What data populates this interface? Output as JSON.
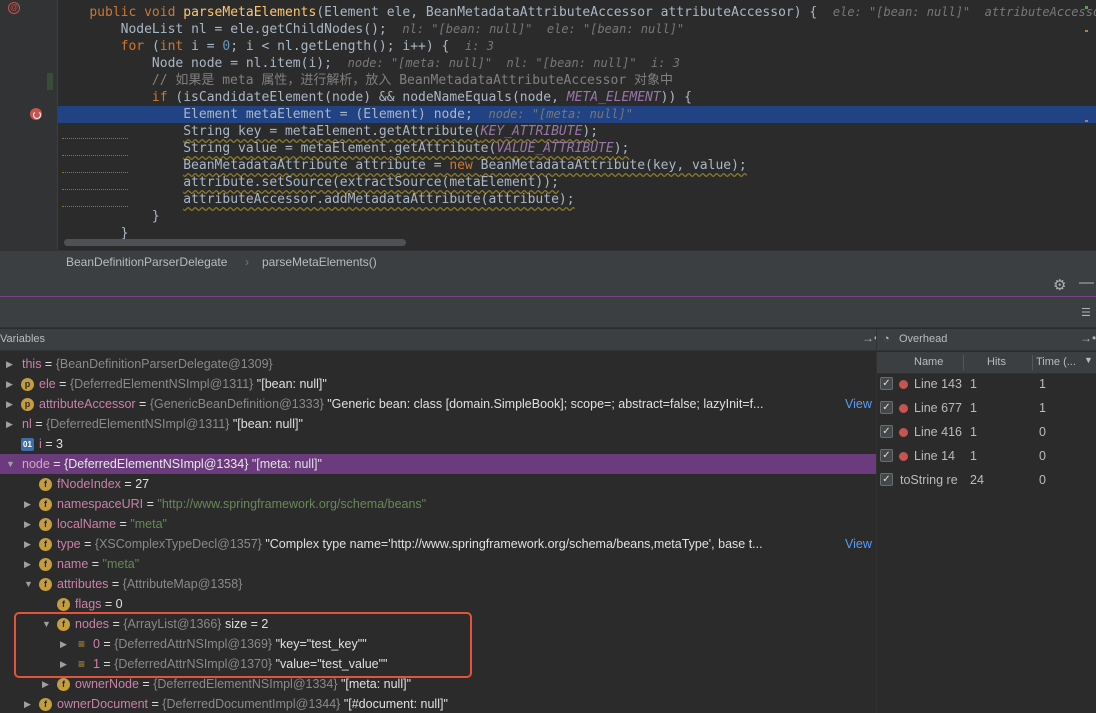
{
  "editor": {
    "line_numbers": [
      "",
      "",
      "",
      "",
      "",
      "",
      "",
      "",
      "",
      "",
      "",
      "",
      "",
      ""
    ],
    "lines": [
      {
        "indent": "    ",
        "segments": [
          [
            "kw",
            "public "
          ],
          [
            "kw",
            "void "
          ],
          [
            "fn",
            "parseMetaElements"
          ],
          [
            "",
            "(Element ele, BeanMetadataAttributeAccessor attributeAccessor) {  "
          ],
          [
            "hint",
            "ele: \"[bean: null]\"  attributeAccessor"
          ]
        ]
      },
      {
        "indent": "        ",
        "segments": [
          [
            "",
            "NodeList nl = ele.getChildNodes();  "
          ],
          [
            "hint",
            "nl: \"[bean: null]\"  ele: \"[bean: null]\""
          ]
        ]
      },
      {
        "indent": "        ",
        "segments": [
          [
            "kw",
            "for "
          ],
          [
            "",
            "("
          ],
          [
            "kw",
            "int "
          ],
          [
            "",
            "i = "
          ],
          [
            "num",
            "0"
          ],
          [
            "",
            "; i < nl.getLength(); i++) {  "
          ],
          [
            "hint",
            "i: 3"
          ]
        ]
      },
      {
        "indent": "            ",
        "segments": [
          [
            "",
            "Node node = nl.item(i);  "
          ],
          [
            "hint",
            "node: \"[meta: null]\"  nl: \"[bean: null]\"  i: 3"
          ]
        ]
      },
      {
        "indent": "            ",
        "segments": [
          [
            "cm",
            "// 如果是 meta 属性，进行解析，放入 BeanMetadataAttributeAccessor 对象中"
          ]
        ]
      },
      {
        "indent": "            ",
        "segments": [
          [
            "kw",
            "if "
          ],
          [
            "",
            "(isCandidateElement(node) && nodeNameEquals(node, "
          ],
          [
            "cst",
            "META_ELEMENT"
          ],
          [
            "",
            ")) {"
          ]
        ]
      },
      {
        "indent": "                ",
        "segments": [
          [
            "",
            "Element metaElement = (Element) node;  "
          ],
          [
            "hint",
            "node: \"[meta: null]\""
          ]
        ]
      },
      {
        "indent": "                ",
        "segments": [
          [
            "",
            "String key = metaElement.getAttribute("
          ],
          [
            "cst",
            "KEY_ATTRIBUTE"
          ],
          [
            "",
            ");"
          ]
        ]
      },
      {
        "indent": "                ",
        "segments": [
          [
            "",
            "String value = metaElement.getAttribute("
          ],
          [
            "cst",
            "VALUE_ATTRIBUTE"
          ],
          [
            "",
            ");"
          ]
        ]
      },
      {
        "indent": "                ",
        "segments": [
          [
            "",
            "BeanMetadataAttribute attribute = "
          ],
          [
            "kw",
            "new "
          ],
          [
            "",
            "BeanMetadataAttribute(key, value);"
          ]
        ]
      },
      {
        "indent": "                ",
        "segments": [
          [
            "",
            "attribute.setSource(extractSource(metaElement));"
          ]
        ]
      },
      {
        "indent": "                ",
        "segments": [
          [
            "",
            "attributeAccessor.addMetadataAttribute(attribute);"
          ]
        ]
      },
      {
        "indent": "            ",
        "segments": [
          [
            "",
            "}"
          ]
        ]
      },
      {
        "indent": "        ",
        "segments": [
          [
            "",
            "}"
          ]
        ]
      }
    ]
  },
  "breadcrumb": {
    "class_name": "BeanDefinitionParserDelegate",
    "method_name": "parseMetaElements()"
  },
  "variables": {
    "header": "Variables",
    "view_label": "View",
    "rows": [
      {
        "level": 0,
        "tri": "▶",
        "icon": "",
        "name": "this",
        "eq": " = ",
        "type": "{BeanDefinitionParserDelegate@1309}",
        "val": ""
      },
      {
        "level": 0,
        "tri": "▶",
        "icon": "p",
        "name": "ele",
        "eq": " = ",
        "type": "{DeferredElementNSImpl@1311}",
        "val": " \"[bean: null]\""
      },
      {
        "level": 0,
        "tri": "▶",
        "icon": "p",
        "name": "attributeAccessor",
        "eq": " = ",
        "type": "{GenericBeanDefinition@1333}",
        "val": " \"Generic bean: class [domain.SimpleBook]; scope=; abstract=false; lazyInit=f...",
        "view": true
      },
      {
        "level": 0,
        "tri": "▶",
        "icon": "",
        "name": "nl",
        "eq": " = ",
        "type": "{DeferredElementNSImpl@1311}",
        "val": " \"[bean: null]\""
      },
      {
        "level": 0,
        "tri": "",
        "icon": "i",
        "name": "i",
        "eq": " = ",
        "type": "",
        "val": "3"
      },
      {
        "level": 0,
        "tri": "▼",
        "icon": "",
        "name": "node",
        "eq": " = ",
        "type": "{DeferredElementNSImpl@1334}",
        "val": " \"[meta: null]\"",
        "sel": true
      },
      {
        "level": 1,
        "tri": "",
        "icon": "f",
        "name": "fNodeIndex",
        "eq": " = ",
        "type": "",
        "val": "27"
      },
      {
        "level": 1,
        "tri": "▶",
        "icon": "f",
        "name": "namespaceURI",
        "eq": " = ",
        "type": "",
        "val": "",
        "str": "\"http://www.springframework.org/schema/beans\""
      },
      {
        "level": 1,
        "tri": "▶",
        "icon": "f",
        "name": "localName",
        "eq": " = ",
        "type": "",
        "val": "",
        "str": "\"meta\""
      },
      {
        "level": 1,
        "tri": "▶",
        "icon": "f",
        "name": "type",
        "eq": " = ",
        "type": "{XSComplexTypeDecl@1357}",
        "val": " \"Complex type name='http://www.springframework.org/schema/beans,metaType',  base t...",
        "view": true
      },
      {
        "level": 1,
        "tri": "▶",
        "icon": "f",
        "name": "name",
        "eq": " = ",
        "type": "",
        "val": "",
        "str": "\"meta\""
      },
      {
        "level": 1,
        "tri": "▼",
        "icon": "f",
        "name": "attributes",
        "eq": " = ",
        "type": "{AttributeMap@1358}",
        "val": ""
      },
      {
        "level": 2,
        "tri": "",
        "icon": "f",
        "name": "flags",
        "eq": " = ",
        "type": "",
        "val": "0"
      },
      {
        "level": 2,
        "tri": "▼",
        "icon": "f",
        "name": "nodes",
        "eq": " = ",
        "type": "{ArrayList@1366}",
        "val": "  size = 2"
      },
      {
        "level": 3,
        "tri": "▶",
        "icon": "lst",
        "name": "0",
        "eq": " = ",
        "type": "{DeferredAttrNSImpl@1369}",
        "val": " \"key=\"test_key\"\""
      },
      {
        "level": 3,
        "tri": "▶",
        "icon": "lst",
        "name": "1",
        "eq": " = ",
        "type": "{DeferredAttrNSImpl@1370}",
        "val": " \"value=\"test_value\"\""
      },
      {
        "level": 2,
        "tri": "▶",
        "icon": "f",
        "name": "ownerNode",
        "eq": " = ",
        "type": "{DeferredElementNSImpl@1334}",
        "val": " \"[meta: null]\""
      },
      {
        "level": 1,
        "tri": "▶",
        "icon": "f",
        "name": "ownerDocument",
        "eq": " = ",
        "type": "{DeferredDocumentImpl@1344}",
        "val": " \"[#document: null]\""
      }
    ]
  },
  "overhead": {
    "title": "Overhead",
    "columns": {
      "name": "Name",
      "hits": "Hits",
      "time": "Time (..."
    },
    "rows": [
      {
        "checked": true,
        "dot": true,
        "name": "Line 143",
        "hits": "1",
        "time": "1"
      },
      {
        "checked": true,
        "dot": true,
        "name": "Line 677",
        "hits": "1",
        "time": "1"
      },
      {
        "checked": true,
        "dot": true,
        "name": "Line 416",
        "hits": "1",
        "time": "0"
      },
      {
        "checked": true,
        "dot": true,
        "name": "Line 14",
        "hits": "1",
        "time": "0"
      },
      {
        "checked": true,
        "dot": false,
        "name": "toString re",
        "hits": "24",
        "time": "0"
      }
    ]
  },
  "colors": {
    "selected_row": "#6c3b7d",
    "highlight_box": "#e5533a",
    "editor_selection": "#214283"
  }
}
